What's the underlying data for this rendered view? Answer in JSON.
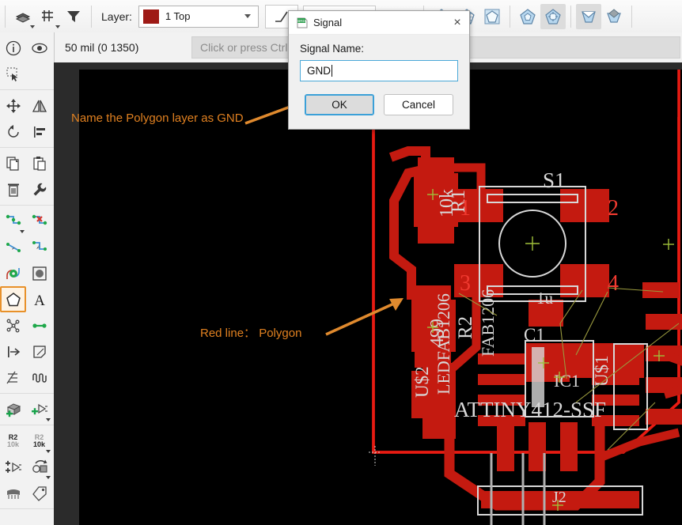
{
  "toolbar": {
    "layer_label": "Layer:",
    "layer_value": "1 Top",
    "layer_color": "#9e1a16",
    "icons": [
      {
        "name": "layers-icon",
        "label": "Layers"
      },
      {
        "name": "grid-icon",
        "label": "Grid"
      },
      {
        "name": "filter-icon",
        "label": "Design Rules Filter"
      },
      {
        "name": "line-style-icon",
        "label": "Line Style"
      },
      {
        "name": "polygon-fill-icon",
        "label": "Polygon Fill"
      },
      {
        "name": "polygon-hatch-icon",
        "label": "Polygon Hatch"
      },
      {
        "name": "polygon-cutout-icon",
        "label": "Polygon Cutout"
      },
      {
        "name": "polygon-orphans-icon",
        "label": "Polygon Orphans"
      },
      {
        "name": "polygon-thermals-icon",
        "label": "Polygon Thermals"
      },
      {
        "name": "polygon-pour-icon",
        "label": "Polygon Pour"
      },
      {
        "name": "polygon-rank-icon",
        "label": "Polygon Rank"
      }
    ]
  },
  "status": {
    "coordinates": "50 mil (0 1350)",
    "command_placeholder": "Click or press Ctrl+L"
  },
  "left_toolbar": {
    "groups": [
      {
        "tools": [
          {
            "name": "info-icon",
            "label": "Info"
          },
          {
            "name": "show-eye-icon",
            "label": "Show"
          },
          {
            "name": "marquee-select-icon",
            "label": "Group"
          }
        ]
      },
      {
        "tools": [
          {
            "name": "move-icon",
            "label": "Move"
          },
          {
            "name": "mirror-icon",
            "label": "Mirror"
          },
          {
            "name": "rotate-icon",
            "label": "Rotate"
          },
          {
            "name": "align-icon",
            "label": "Align"
          }
        ]
      },
      {
        "tools": [
          {
            "name": "copy-icon",
            "label": "Copy"
          },
          {
            "name": "paste-icon",
            "label": "Paste"
          },
          {
            "name": "delete-trash-icon",
            "label": "Delete"
          },
          {
            "name": "wrench-icon",
            "label": "Change"
          }
        ]
      },
      {
        "tools": [
          {
            "name": "route-icon",
            "label": "Route"
          },
          {
            "name": "ripup-icon",
            "label": "Ripup"
          },
          {
            "name": "split-icon",
            "label": "Split"
          },
          {
            "name": "miter-icon",
            "label": "Miter"
          },
          {
            "name": "via-icon",
            "label": "Via"
          },
          {
            "name": "hole-icon",
            "label": "Hole"
          },
          {
            "name": "polygon-tool-icon",
            "label": "Polygon",
            "selected": true
          },
          {
            "name": "text-tool-icon",
            "label": "Text"
          },
          {
            "name": "dimension-icon",
            "label": "Dimension"
          },
          {
            "name": "wire-icon",
            "label": "Wire"
          },
          {
            "name": "arrow-right-icon",
            "label": "Pad"
          },
          {
            "name": "smd-icon",
            "label": "SMD"
          },
          {
            "name": "array-icon",
            "label": "Array"
          },
          {
            "name": "signal-wave-icon",
            "label": "Signal"
          }
        ]
      },
      {
        "tools": [
          {
            "name": "add-package-icon",
            "label": "Add Package"
          },
          {
            "name": "add-part-icon",
            "label": "Add Part"
          }
        ]
      },
      {
        "tools": [
          {
            "name": "name-r2-icon",
            "label": "Name"
          },
          {
            "name": "value-10k-icon",
            "label": "Value"
          },
          {
            "name": "replace-part-icon",
            "label": "Replace"
          },
          {
            "name": "rotate-part-icon",
            "label": "Rotate Part"
          },
          {
            "name": "chip-icon",
            "label": "Package"
          },
          {
            "name": "attribute-tag-icon",
            "label": "Attribute"
          }
        ]
      }
    ]
  },
  "dialog": {
    "title": "Signal",
    "icon": "brd-file-icon",
    "close_label": "×",
    "field_label": "Signal Name:",
    "field_value": "GND",
    "ok_label": "OK",
    "cancel_label": "Cancel"
  },
  "annotations": [
    {
      "name": "annotation-name-polygon",
      "text": "Name the Polygon layer as GND",
      "color": "#e08020"
    },
    {
      "name": "annotation-red-line",
      "text": "Red line： Polygon",
      "color": "#e08020"
    }
  ],
  "board": {
    "outline_color": "#e81b12",
    "copper_color": "#c41a10",
    "silkscreen_color": "#d8d8d8",
    "airwire_color": "#9a9a3e",
    "background": "#000000",
    "components": [
      {
        "ref": "S1",
        "value": ""
      },
      {
        "ref": "R1",
        "value": "10k"
      },
      {
        "ref": "R2",
        "value": "499"
      },
      {
        "ref": "C1",
        "value": "1u"
      },
      {
        "ref": "U$1",
        "value": ""
      },
      {
        "ref": "U$2",
        "value": "LEDFAB1206"
      },
      {
        "ref": "IC1",
        "value": "ATTINY412-SSF"
      },
      {
        "ref": "J2",
        "value": ""
      }
    ],
    "pin_numbers": [
      "1",
      "2",
      "3",
      "4"
    ]
  }
}
